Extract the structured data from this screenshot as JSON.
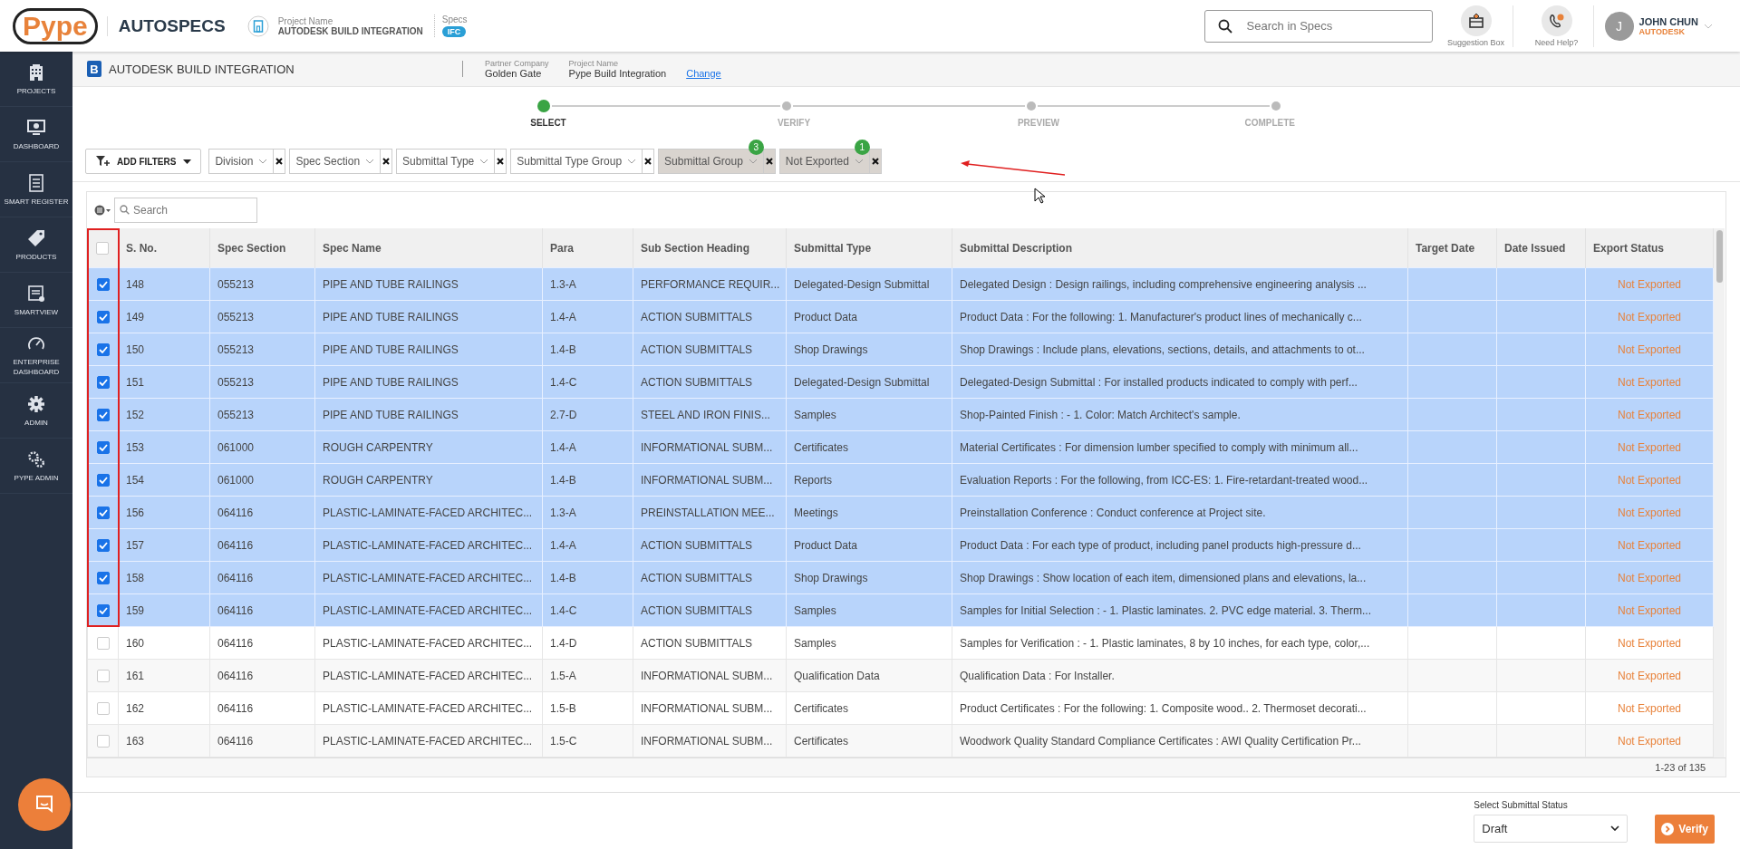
{
  "header": {
    "logo": "Pype",
    "app_name": "AUTOSPECS",
    "project_label": "Project Name",
    "project_name": "AUTODESK BUILD INTEGRATION",
    "specs_label": "Specs",
    "specs_badge": "IFC",
    "search": {
      "placeholder": "Search in Specs"
    },
    "actions": [
      "Suggestion Box",
      "Need Help?"
    ],
    "user": {
      "initial": "J",
      "name": "JOHN CHUN",
      "company": "AUTODESK"
    }
  },
  "sidebar": {
    "items": [
      {
        "label": "PROJECTS"
      },
      {
        "label": "DASHBOARD"
      },
      {
        "label": "SMART REGISTER"
      },
      {
        "label": "PRODUCTS"
      },
      {
        "label": "SMARTVIEW"
      },
      {
        "label": "ENTERPRISE DASHBOARD"
      },
      {
        "label": "ADMIN"
      },
      {
        "label": "PYPE ADMIN"
      }
    ]
  },
  "subheader": {
    "logo_letter": "B",
    "title": "AUTODESK BUILD INTEGRATION",
    "partner_label": "Partner Company",
    "partner": "Golden Gate",
    "project_label": "Project Name",
    "project": "Pype Build Integration",
    "change_link": "Change"
  },
  "stepper": [
    {
      "label": "SELECT",
      "selected": true
    },
    {
      "label": "VERIFY",
      "selected": false
    },
    {
      "label": "PREVIEW",
      "selected": false
    },
    {
      "label": "COMPLETE",
      "selected": false
    }
  ],
  "filters": {
    "add_label": "ADD FILTERS",
    "items": [
      {
        "label": "Division",
        "applied": false
      },
      {
        "label": "Spec Section",
        "applied": false
      },
      {
        "label": "Submittal Type",
        "applied": false
      },
      {
        "label": "Submittal Type Group",
        "applied": false
      },
      {
        "label": "Submittal Group",
        "applied": true,
        "count": "3"
      },
      {
        "label": "Not Exported",
        "applied": true,
        "count": "1"
      }
    ]
  },
  "table": {
    "search": {
      "placeholder": "Search"
    },
    "select_all": {
      "checked": false
    },
    "columns": [
      "S. No.",
      "Spec Section",
      "Spec Name",
      "Para",
      "Sub Section Heading",
      "Submittal Type",
      "Submittal Description",
      "Target Date",
      "Date Issued",
      "Export Status"
    ],
    "rows": [
      {
        "selected": true,
        "sno": "148",
        "section": "055213",
        "name": "PIPE AND TUBE RAILINGS",
        "para": "1.3-A",
        "heading": "PERFORMANCE REQUIR...",
        "type": "Delegated-Design Submittal",
        "description": "Delegated Design : Design railings, including comprehensive engineering analysis ...",
        "status": "Not Exported"
      },
      {
        "selected": true,
        "sno": "149",
        "section": "055213",
        "name": "PIPE AND TUBE RAILINGS",
        "para": "1.4-A",
        "heading": "ACTION SUBMITTALS",
        "type": "Product Data",
        "description": "Product Data : For the following: 1. Manufacturer's product lines of mechanically c...",
        "status": "Not Exported"
      },
      {
        "selected": true,
        "sno": "150",
        "section": "055213",
        "name": "PIPE AND TUBE RAILINGS",
        "para": "1.4-B",
        "heading": "ACTION SUBMITTALS",
        "type": "Shop Drawings",
        "description": "Shop Drawings : Include plans, elevations, sections, details, and attachments to ot...",
        "status": "Not Exported"
      },
      {
        "selected": true,
        "sno": "151",
        "section": "055213",
        "name": "PIPE AND TUBE RAILINGS",
        "para": "1.4-C",
        "heading": "ACTION SUBMITTALS",
        "type": "Delegated-Design Submittal",
        "description": "Delegated-Design Submittal : For installed products indicated to comply with perf...",
        "status": "Not Exported"
      },
      {
        "selected": true,
        "sno": "152",
        "section": "055213",
        "name": "PIPE AND TUBE RAILINGS",
        "para": "2.7-D",
        "heading": "STEEL AND IRON FINIS...",
        "type": "Samples",
        "description": "Shop-Painted Finish : - 1. Color: Match Architect's sample.",
        "status": "Not Exported"
      },
      {
        "selected": true,
        "sno": "153",
        "section": "061000",
        "name": "ROUGH CARPENTRY",
        "para": "1.4-A",
        "heading": "INFORMATIONAL SUBM...",
        "type": "Certificates",
        "description": "Material Certificates : For dimension lumber specified to comply with minimum all...",
        "status": "Not Exported"
      },
      {
        "selected": true,
        "sno": "154",
        "section": "061000",
        "name": "ROUGH CARPENTRY",
        "para": "1.4-B",
        "heading": "INFORMATIONAL SUBM...",
        "type": "Reports",
        "description": "Evaluation Reports : For the following, from ICC-ES: 1. Fire-retardant-treated wood...",
        "status": "Not Exported"
      },
      {
        "selected": true,
        "sno": "156",
        "section": "064116",
        "name": "PLASTIC-LAMINATE-FACED ARCHITEC...",
        "para": "1.3-A",
        "heading": "PREINSTALLATION MEE...",
        "type": "Meetings",
        "description": "Preinstallation Conference : Conduct conference at Project site.",
        "status": "Not Exported"
      },
      {
        "selected": true,
        "sno": "157",
        "section": "064116",
        "name": "PLASTIC-LAMINATE-FACED ARCHITEC...",
        "para": "1.4-A",
        "heading": "ACTION SUBMITTALS",
        "type": "Product Data",
        "description": "Product Data : For each type of product, including panel products high-pressure d...",
        "status": "Not Exported"
      },
      {
        "selected": true,
        "sno": "158",
        "section": "064116",
        "name": "PLASTIC-LAMINATE-FACED ARCHITEC...",
        "para": "1.4-B",
        "heading": "ACTION SUBMITTALS",
        "type": "Shop Drawings",
        "description": "Shop Drawings : Show location of each item, dimensioned plans and elevations, la...",
        "status": "Not Exported"
      },
      {
        "selected": true,
        "sno": "159",
        "section": "064116",
        "name": "PLASTIC-LAMINATE-FACED ARCHITEC...",
        "para": "1.4-C",
        "heading": "ACTION SUBMITTALS",
        "type": "Samples",
        "description": "Samples for Initial Selection : - 1. Plastic laminates. 2. PVC edge material. 3. Therm...",
        "status": "Not Exported"
      },
      {
        "selected": false,
        "sno": "160",
        "section": "064116",
        "name": "PLASTIC-LAMINATE-FACED ARCHITEC...",
        "para": "1.4-D",
        "heading": "ACTION SUBMITTALS",
        "type": "Samples",
        "description": "Samples for Verification : - 1. Plastic laminates, 8 by 10 inches, for each type, color,...",
        "status": "Not Exported"
      },
      {
        "selected": false,
        "sno": "161",
        "section": "064116",
        "name": "PLASTIC-LAMINATE-FACED ARCHITEC...",
        "para": "1.5-A",
        "heading": "INFORMATIONAL SUBM...",
        "type": "Qualification Data",
        "description": "Qualification Data : For Installer.",
        "status": "Not Exported"
      },
      {
        "selected": false,
        "sno": "162",
        "section": "064116",
        "name": "PLASTIC-LAMINATE-FACED ARCHITEC...",
        "para": "1.5-B",
        "heading": "INFORMATIONAL SUBM...",
        "type": "Certificates",
        "description": "Product Certificates : For the following: 1. Composite wood.. 2. Thermoset decorati...",
        "status": "Not Exported"
      },
      {
        "selected": false,
        "sno": "163",
        "section": "064116",
        "name": "PLASTIC-LAMINATE-FACED ARCHITEC...",
        "para": "1.5-C",
        "heading": "INFORMATIONAL SUBM...",
        "type": "Certificates",
        "description": "Woodwork Quality Standard Compliance Certificates : AWI Quality Certification Pr...",
        "status": "Not Exported"
      }
    ],
    "pagination": "1-23 of 135"
  },
  "footer": {
    "status_label": "Select Submittal Status",
    "status_value": "Draft",
    "verify_button": "Verify"
  }
}
